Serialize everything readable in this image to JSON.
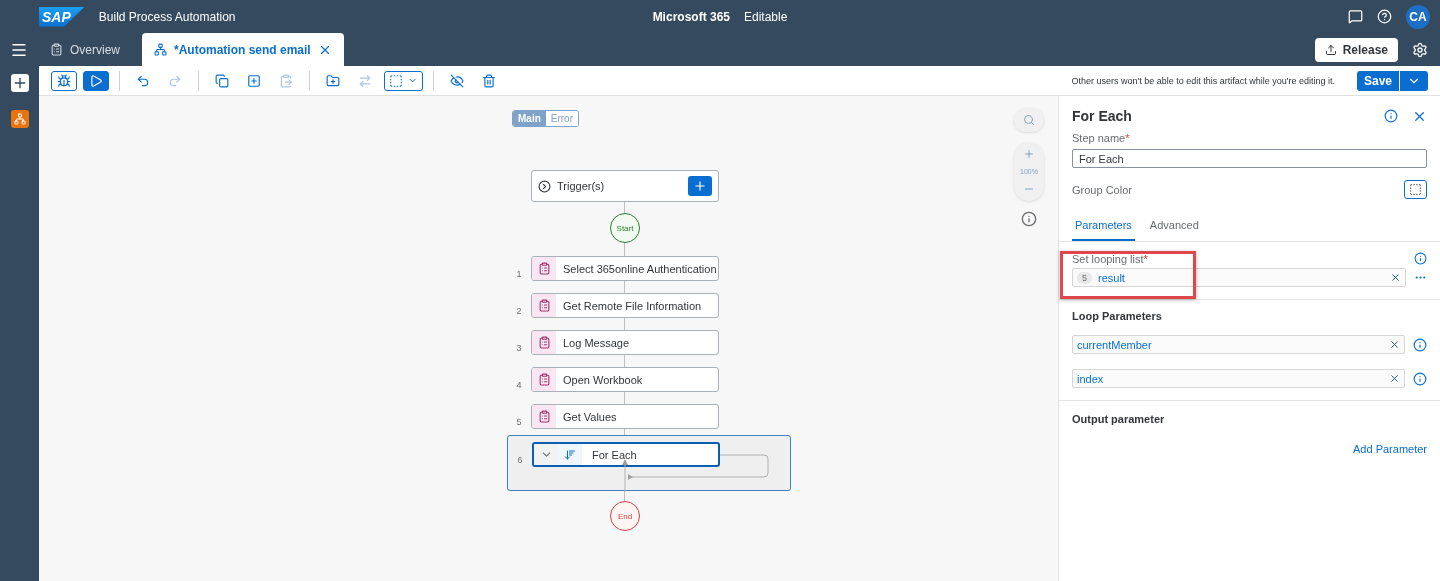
{
  "shell": {
    "logo": "SAP",
    "product": "Build Process Automation",
    "project": "Microsoft 365",
    "status": "Editable",
    "avatar": "CA"
  },
  "tabs": [
    {
      "label": "Overview",
      "selected": false,
      "kind": "overview"
    },
    {
      "label": "*Automation send email",
      "selected": true,
      "kind": "process"
    }
  ],
  "release_button": "Release",
  "toolbar": [
    {
      "kind": "debug",
      "disabled": false
    },
    {
      "kind": "run",
      "disabled": false
    },
    {
      "kind": "sep"
    },
    {
      "kind": "undo",
      "disabled": false
    },
    {
      "kind": "redo",
      "disabled": true
    },
    {
      "kind": "sep"
    },
    {
      "kind": "copy",
      "disabled": false
    },
    {
      "kind": "duplicate",
      "disabled": false
    },
    {
      "kind": "paste",
      "disabled": true
    },
    {
      "kind": "sep"
    },
    {
      "kind": "add-group",
      "disabled": false
    },
    {
      "kind": "swap",
      "disabled": true
    },
    {
      "kind": "select",
      "disabled": false
    },
    {
      "kind": "sep"
    },
    {
      "kind": "hide",
      "disabled": false
    },
    {
      "kind": "delete",
      "disabled": false
    }
  ],
  "edit_notice": "Other users won't be able to edit this artifact while you're editing it.",
  "save_button": "Save",
  "canvas": {
    "mode_toggle": [
      {
        "label": "Main",
        "selected": true
      },
      {
        "label": "Error",
        "selected": false
      }
    ],
    "trigger": "Trigger(s)",
    "start": "Start",
    "end": "End",
    "zoom": "100%",
    "steps": [
      {
        "number": "1",
        "label": "Select 365online Authentication",
        "kind": "activity",
        "selected": false
      },
      {
        "number": "2",
        "label": "Get Remote File Information",
        "kind": "activity",
        "selected": false
      },
      {
        "number": "3",
        "label": "Log Message",
        "kind": "activity",
        "selected": false
      },
      {
        "number": "4",
        "label": "Open Workbook",
        "kind": "activity",
        "selected": false
      },
      {
        "number": "5",
        "label": "Get Values",
        "kind": "activity",
        "selected": false
      },
      {
        "number": "6",
        "label": "For Each",
        "kind": "loop",
        "selected": true
      }
    ]
  },
  "panel": {
    "title": "For Each",
    "step_name": {
      "label": "Step name",
      "required_mark": "*",
      "value": "For Each"
    },
    "group_color": {
      "label": "Group Color"
    },
    "tabs": [
      {
        "label": "Parameters",
        "selected": true
      },
      {
        "label": "Advanced",
        "selected": false
      }
    ],
    "looping_list": {
      "label": "Set looping list",
      "required_mark": "*",
      "token_number": "5",
      "token": "result",
      "highlighted": true
    },
    "loop_parameters": {
      "heading": "Loop Parameters",
      "items": [
        "currentMember",
        "index"
      ]
    },
    "output": {
      "heading": "Output parameter",
      "add": "Add Parameter"
    }
  }
}
